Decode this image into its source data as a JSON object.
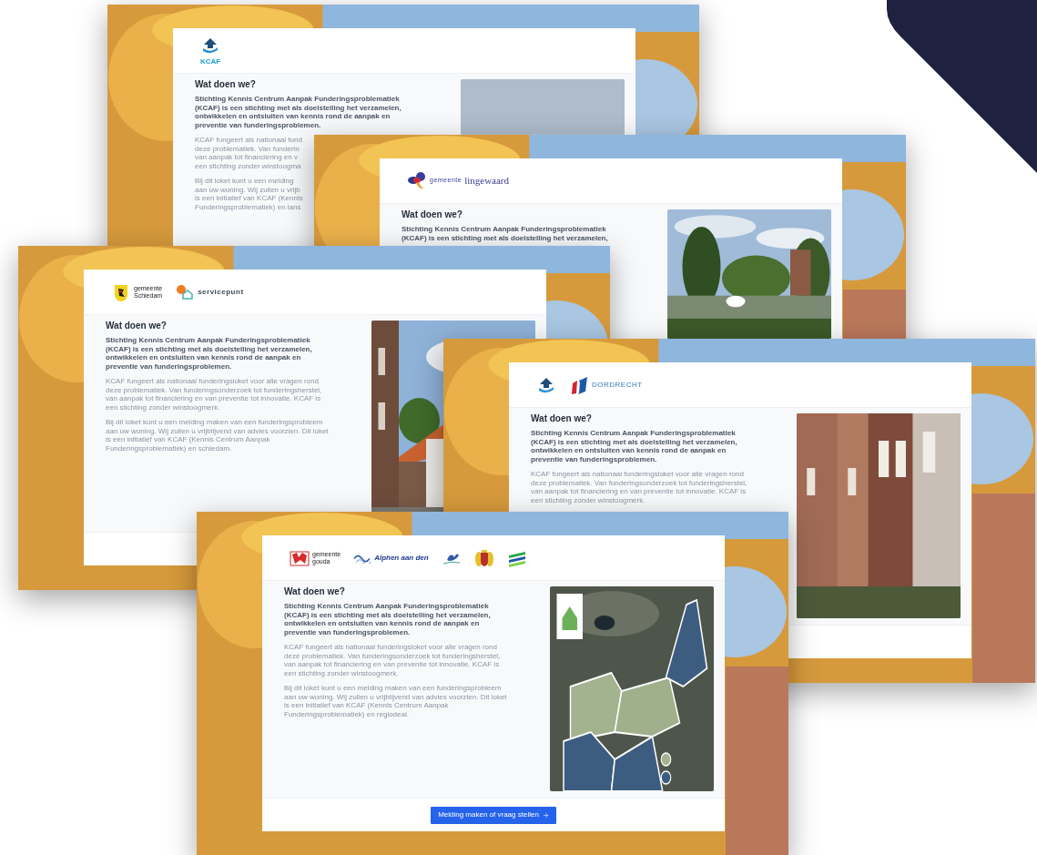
{
  "windows": [
    {
      "logos": [
        {
          "kind": "kcaf",
          "texts": [
            "KCAF"
          ]
        }
      ],
      "heading": "Wat doen we?",
      "paragraphs": [
        {
          "bold": true,
          "lines": [
            "Stichting Kennis Centrum Aanpak Funderingsproblematiek",
            "(KCAF) is een stichting met als doelstelling het verzamelen,",
            "ontwikkelen en ontsluiten van kennis rond de aanpak en",
            "preventie van funderingsproblemen."
          ]
        },
        {
          "bold": false,
          "lines": [
            "KCAF fungeert als nationaal fund",
            "deze problematiek. Van funderin",
            "van aanpak tot financiering en v",
            "een stichting zonder winstoogma"
          ]
        },
        {
          "bold": false,
          "lines": [
            "Bij dit loket kunt u een melding",
            "aan uw woning. Wij zullen u vrijb",
            "is een initiatief van KCAF (Kennis",
            "Funderingsproblematiek) en lans"
          ]
        }
      ]
    },
    {
      "logos": [
        {
          "kind": "butterfly",
          "texts": [
            "gemeente",
            "lingewaard"
          ]
        }
      ],
      "heading": "Wat doen we?",
      "paragraphs": [
        {
          "bold": true,
          "lines": [
            "Stichting Kennis Centrum Aanpak Funderingsproblematiek",
            "(KCAF) is een stichting met als doelstelling het verzamelen,"
          ]
        }
      ]
    },
    {
      "logos": [
        {
          "kind": "shield",
          "texts": [
            "gemeente",
            "Schiedam"
          ]
        },
        {
          "kind": "servicepunt",
          "texts": [
            "servicepunt"
          ]
        }
      ],
      "heading": "Wat doen we?",
      "paragraphs": [
        {
          "bold": true,
          "lines": [
            "Stichting Kennis Centrum Aanpak Funderingsproblematiek",
            "(KCAF) is een stichting met als doelstelling het verzamelen,",
            "ontwikkelen en ontsluiten van kennis rond de aanpak en",
            "preventie van funderingsproblemen."
          ]
        },
        {
          "bold": false,
          "lines": [
            "KCAF fungeert als nationaal funderingsloket voor alle vragen rond",
            "deze problematiek. Van funderingsonderzoek tot funderingsherstel,",
            "van aanpak tot financiering en van preventie tot innovatie. KCAF is",
            "een stichting zonder winstoogmerk."
          ]
        },
        {
          "bold": false,
          "lines": [
            "Bij dit loket kunt u een melding maken van een funderingsprobleem",
            "aan uw woning. Wij zullen u vrijblijvend van advies voorzien. Dit loket",
            "is een initiatief van KCAF (Kennis Centrum Aanpak",
            "Funderingsproblematiek) en schiedam."
          ]
        }
      ]
    },
    {
      "logos": [
        {
          "kind": "kcafsmall"
        },
        {
          "kind": "dordrecht",
          "texts": [
            "DORDRECHT"
          ]
        }
      ],
      "heading": "Wat doen we?",
      "paragraphs": [
        {
          "bold": true,
          "lines": [
            "Stichting Kennis Centrum Aanpak Funderingsproblematiek",
            "(KCAF) is een stichting met als doelstelling het verzamelen,",
            "ontwikkelen en ontsluiten van kennis rond de aanpak en",
            "preventie van funderingsproblemen."
          ]
        },
        {
          "bold": false,
          "lines": [
            "KCAF fungeert als nationaal funderingsloket voor alle vragen rond",
            "deze problematiek. Van funderingsonderzoek tot funderingsherstel,",
            "van aanpak tot financiering en van preventie tot innovatie. KCAF is",
            "een stichting zonder winstoogmerk."
          ]
        }
      ]
    },
    {
      "logos": [
        {
          "kind": "gouda",
          "texts": [
            "gemeente",
            "gouda"
          ]
        },
        {
          "kind": "alphen",
          "texts": [
            "Alphen aan den"
          ]
        },
        {
          "kind": "bird"
        },
        {
          "kind": "crest"
        },
        {
          "kind": "stripes"
        }
      ],
      "heading": "Wat doen we?",
      "paragraphs": [
        {
          "bold": true,
          "lines": [
            "Stichting Kennis Centrum Aanpak Funderingsproblematiek",
            "(KCAF) is een stichting met als doelstelling het verzamelen,",
            "ontwikkelen en ontsluiten van kennis rond de aanpak en",
            "preventie van funderingsproblemen."
          ]
        },
        {
          "bold": false,
          "lines": [
            "KCAF fungeert als nationaal funderingsloket voor alle vragen rond",
            "deze problematiek. Van funderingsonderzoek tot funderingsherstel,",
            "van aanpak tot financiering en van preventie tot innovatie. KCAF is",
            "een stichting zonder winstoogmerk."
          ]
        },
        {
          "bold": false,
          "lines": [
            "Bij dit loket kunt u een melding maken van een funderingsprobleem",
            "aan uw woning. Wij zullen u vrijblijvend van advies voorzien. Dit loket",
            "is een initiatief van KCAF (Kennis Centrum Aanpak",
            "Funderingsproblematiek) en regiodeal."
          ]
        }
      ],
      "button": "Melding maken of vraag stellen"
    }
  ]
}
